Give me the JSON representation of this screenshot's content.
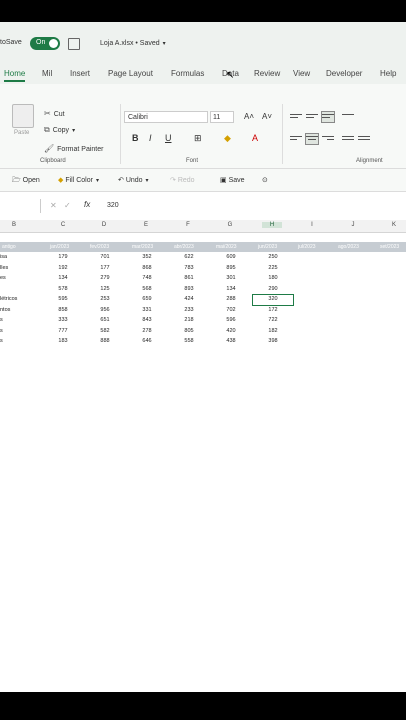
{
  "titlebar": {
    "autosave_label": "toSave",
    "toggle_label": "On",
    "doc_title": "Loja A.xlsx • Saved"
  },
  "tabs": [
    "Home",
    "Mil",
    "Insert",
    "Page Layout",
    "Formulas",
    "Data",
    "Review",
    "View",
    "Developer",
    "Help"
  ],
  "ribbon": {
    "paste": "Paste",
    "cut": "Cut",
    "copy": "Copy",
    "format_painter": "Format Painter",
    "font_name": "Calibri",
    "font_size": "11",
    "groups": {
      "clipboard": "Clipboard",
      "font": "Font",
      "alignment": "Alignment"
    }
  },
  "quick_access": {
    "open": "Open",
    "fill_color": "Fill Color",
    "undo": "Undo",
    "redo": "Redo",
    "save": "Save"
  },
  "formula_bar": {
    "fx": "fx",
    "value": "320"
  },
  "column_headers": [
    "B",
    "C",
    "D",
    "E",
    "F",
    "G",
    "H",
    "I",
    "J",
    "K"
  ],
  "header_row": [
    "antigo",
    "jan/2023",
    "fev/2023",
    "mar/2023",
    "abr/2023",
    "mai/2023",
    "jun/2023",
    "jul/2023",
    "ago/2023",
    "set/2023"
  ],
  "rows": [
    {
      "label": "isa",
      "values": [
        "179",
        "701",
        "352",
        "622",
        "609",
        "250"
      ]
    },
    {
      "label": "lles",
      "values": [
        "192",
        "177",
        "868",
        "783",
        "895",
        "225"
      ]
    },
    {
      "label": "es",
      "values": [
        "134",
        "279",
        "748",
        "861",
        "301",
        "180"
      ]
    },
    {
      "label": "",
      "values": [
        "578",
        "125",
        "568",
        "893",
        "134",
        "290"
      ]
    },
    {
      "label": "létricos",
      "values": [
        "595",
        "253",
        "659",
        "424",
        "288",
        "320"
      ]
    },
    {
      "label": "ntos",
      "values": [
        "858",
        "956",
        "331",
        "233",
        "702",
        "172"
      ]
    },
    {
      "label": "s",
      "values": [
        "333",
        "651",
        "843",
        "218",
        "596",
        "722"
      ]
    },
    {
      "label": "s",
      "values": [
        "777",
        "582",
        "278",
        "805",
        "420",
        "182"
      ]
    },
    {
      "label": "s",
      "values": [
        "183",
        "888",
        "646",
        "558",
        "438",
        "398"
      ]
    }
  ]
}
